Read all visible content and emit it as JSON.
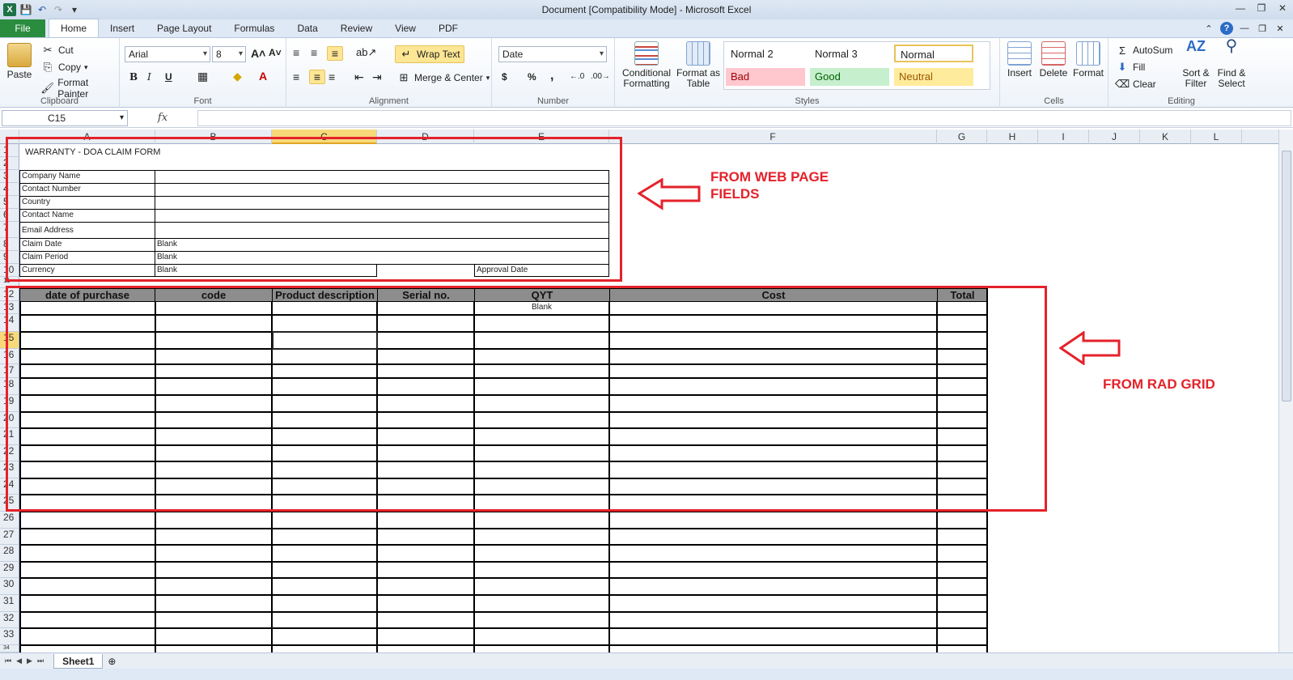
{
  "window": {
    "title": "Document  [Compatibility Mode]  -  Microsoft Excel"
  },
  "tabs": [
    "File",
    "Home",
    "Insert",
    "Page Layout",
    "Formulas",
    "Data",
    "Review",
    "View",
    "PDF"
  ],
  "ribbon": {
    "clipboard": {
      "label": "Clipboard",
      "paste": "Paste",
      "cut": "Cut",
      "copy": "Copy",
      "format_painter": "Format Painter"
    },
    "font": {
      "label": "Font",
      "name": "Arial",
      "size": "8",
      "bold": "B",
      "italic": "I",
      "underline": "U"
    },
    "alignment": {
      "label": "Alignment",
      "wrap_text": "Wrap Text",
      "merge_center": "Merge & Center"
    },
    "number": {
      "label": "Number",
      "format": "Date",
      "currency": "$",
      "percent": "%",
      "comma": ","
    },
    "styles": {
      "label": "Styles",
      "conditional": "Conditional Formatting",
      "format_table": "Format as Table",
      "items": [
        "Normal 2",
        "Normal 3",
        "Normal",
        "Bad",
        "Good",
        "Neutral"
      ]
    },
    "cells": {
      "label": "Cells",
      "insert": "Insert",
      "delete": "Delete",
      "format": "Format"
    },
    "editing": {
      "label": "Editing",
      "autosum": "AutoSum",
      "fill": "Fill",
      "clear": "Clear",
      "sort": "Sort & Filter",
      "find": "Find & Select"
    }
  },
  "formula_bar": {
    "name_box": "C15",
    "fx": "fx",
    "value": ""
  },
  "columns": [
    "A",
    "B",
    "C",
    "D",
    "E",
    "F",
    "G",
    "H",
    "I",
    "J",
    "K",
    "L"
  ],
  "rows": [
    "1",
    "2",
    "3",
    "4",
    "5",
    "6",
    "7",
    "8",
    "9",
    "10",
    "11",
    "12",
    "13",
    "14",
    "15",
    "16",
    "17",
    "18",
    "19",
    "20",
    "21",
    "22",
    "23",
    "24",
    "25",
    "26",
    "27",
    "28",
    "29",
    "30",
    "31",
    "32",
    "33",
    "34"
  ],
  "form": {
    "title": "WARRANTY - DOA CLAIM FORM",
    "labels": [
      "Company Name",
      "Contact Number",
      "Country",
      "Contact Name",
      "Email Address",
      "Claim Date",
      "Claim Period",
      "Currency"
    ],
    "claim_date_value": "Blank",
    "claim_period_value": "Blank",
    "currency_value": "Blank",
    "approval_date": "Approval Date"
  },
  "grid_headers": [
    "date of purchase",
    "code",
    "Product description",
    "Serial no.",
    "QYT",
    "Cost",
    "Total"
  ],
  "qyt_first": "Blank",
  "annotations": {
    "web": "FROM WEB PAGE FIELDS",
    "rad": "FROM RAD GRID"
  },
  "sheet_tab": "Sheet1",
  "colors": {
    "annotation": "#e4222b",
    "header_fill": "#8d8d8d",
    "file_tab": "#2a8c3f"
  }
}
